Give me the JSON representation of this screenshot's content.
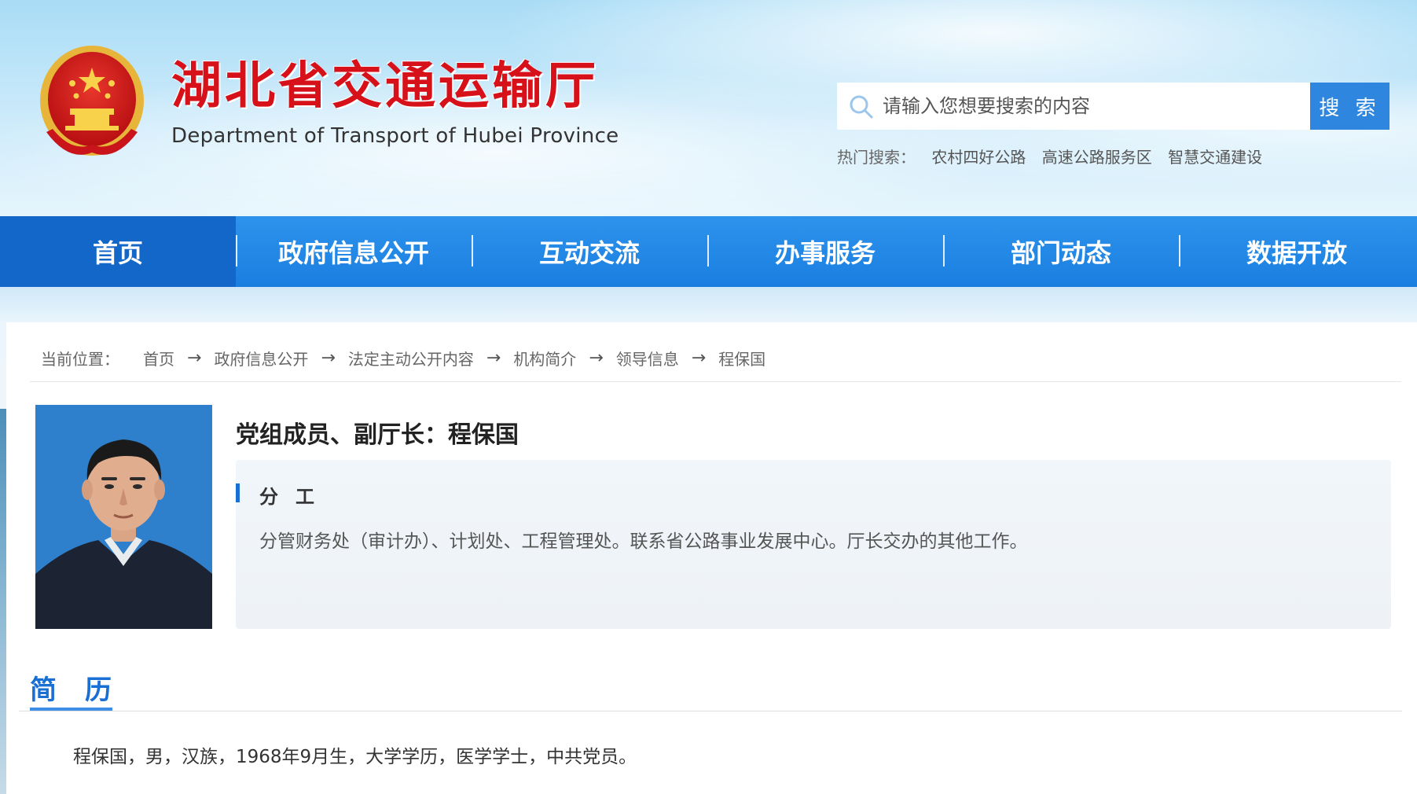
{
  "header": {
    "title": "湖北省交通运输厅",
    "subtitle": "Department of Transport of Hubei Province",
    "emblem_icon": "national-emblem-icon"
  },
  "search": {
    "placeholder": "请输入您想要搜索的内容",
    "button_label": "搜 索",
    "hot_label": "热门搜索：",
    "hot_items": [
      "农村四好公路",
      "高速公路服务区",
      "智慧交通建设"
    ]
  },
  "nav": {
    "items": [
      "首页",
      "政府信息公开",
      "互动交流",
      "办事服务",
      "部门动态",
      "数据开放"
    ],
    "active_index": 0
  },
  "breadcrumb": {
    "label": "当前位置：",
    "items": [
      "首页",
      "政府信息公开",
      "法定主动公开内容",
      "机构简介",
      "领导信息",
      "程保国"
    ],
    "separator": "→"
  },
  "profile": {
    "title": "党组成员、副厅长：程保国",
    "duty_heading": "分工",
    "duty_text": "分管财务处（审计办）、计划处、工程管理处。联系省公路事业发展中心。厅长交办的其他工作。",
    "resume_heading": "简历",
    "resume_text": "程保国，男，汉族，1968年9月生，大学学历，医学学士，中共党员。"
  },
  "colors": {
    "brand_red": "#d7111a",
    "nav_blue": "#1a7ee0",
    "accent_blue": "#1a6fd4",
    "search_button": "#2e86de"
  }
}
